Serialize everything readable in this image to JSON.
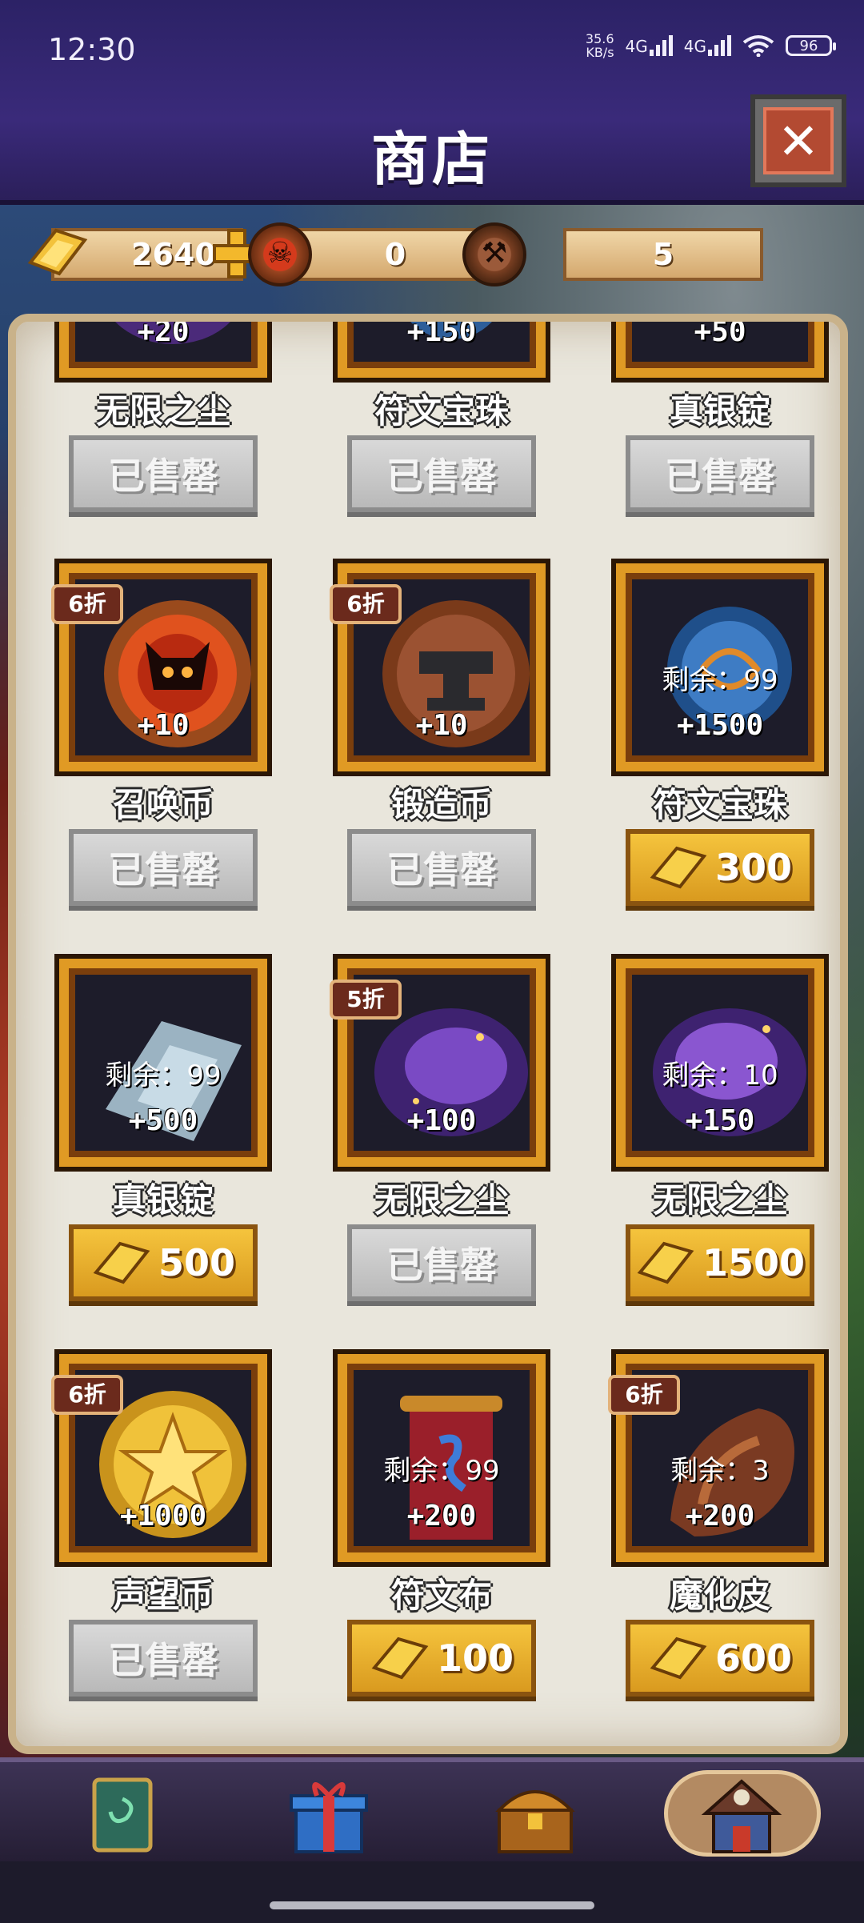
{
  "status_bar": {
    "time": "12:30",
    "net_speed_top": "35.6",
    "net_speed_bottom": "KB/s",
    "net_type_1": "4G",
    "net_type_2": "4G",
    "battery": "96"
  },
  "header": {
    "title": "商店",
    "close_icon": "close-icon"
  },
  "currency": {
    "gold": "2640",
    "summon_coin": "0",
    "forge_coin": "5"
  },
  "items": [
    {
      "amount": "+20",
      "name": "无限之尘",
      "button": "已售罄",
      "sold": true
    },
    {
      "amount": "+150",
      "name": "符文宝珠",
      "button": "已售罄",
      "sold": true
    },
    {
      "amount": "+50",
      "name": "真银锭",
      "button": "已售罄",
      "sold": true
    },
    {
      "discount": "6折",
      "amount": "+10",
      "name": "召唤币",
      "button": "已售罄",
      "sold": true
    },
    {
      "discount": "6折",
      "amount": "+10",
      "name": "锻造币",
      "button": "已售罄",
      "sold": true
    },
    {
      "remaining": "剩余：99",
      "amount": "+1500",
      "name": "符文宝珠",
      "button": "300",
      "sold": false
    },
    {
      "remaining": "剩余：99",
      "amount": "+500",
      "name": "真银锭",
      "button": "500",
      "sold": false
    },
    {
      "discount": "5折",
      "amount": "+100",
      "name": "无限之尘",
      "button": "已售罄",
      "sold": true
    },
    {
      "remaining": "剩余：10",
      "amount": "+150",
      "name": "无限之尘",
      "button": "1500",
      "sold": false
    },
    {
      "discount": "6折",
      "amount": "+1000",
      "name": "声望币",
      "button": "已售罄",
      "sold": true
    },
    {
      "remaining": "剩余：99",
      "amount": "+200",
      "name": "符文布",
      "button": "100",
      "sold": false
    },
    {
      "discount": "6折",
      "remaining": "剩余：3",
      "amount": "+200",
      "name": "魔化皮",
      "button": "600",
      "sold": false
    }
  ],
  "bottom_nav": [
    "card-icon",
    "gift-icon",
    "treasure-chest-icon",
    "shop-house-icon"
  ],
  "colors": {
    "accent_gold": "#e09a24",
    "header_bg": "#3a2a7a",
    "panel_bg": "#e9e6dc"
  }
}
